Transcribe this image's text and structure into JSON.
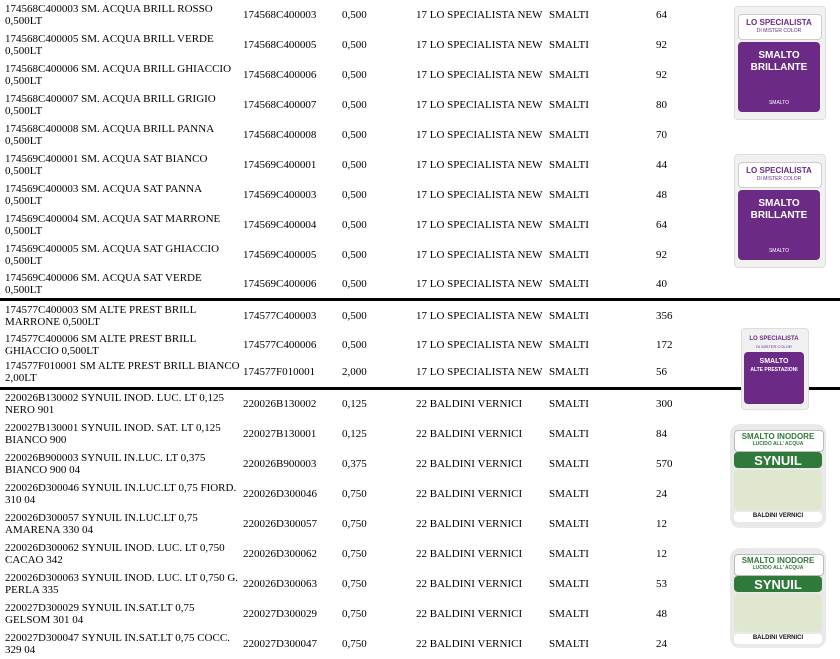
{
  "rows": [
    {
      "desc": "174568C400003 SM. ACQUA BRILL ROSSO\n0,500LT",
      "code": "174568C400003",
      "qty": "0,500",
      "supplier": "17 LO SPECIALISTA NEW",
      "category": "SMALTI",
      "value": "64"
    },
    {
      "desc": "174568C400005 SM. ACQUA BRILL VERDE\n0,500LT",
      "code": "174568C400005",
      "qty": "0,500",
      "supplier": "17 LO SPECIALISTA NEW",
      "category": "SMALTI",
      "value": "92"
    },
    {
      "desc": "174568C400006 SM. ACQUA BRILL GHIACCIO\n0,500LT",
      "code": "174568C400006",
      "qty": "0,500",
      "supplier": "17 LO SPECIALISTA NEW",
      "category": "SMALTI",
      "value": "92"
    },
    {
      "desc": "174568C400007 SM. ACQUA BRILL GRIGIO\n0,500LT",
      "code": "174568C400007",
      "qty": "0,500",
      "supplier": "17 LO SPECIALISTA NEW",
      "category": "SMALTI",
      "value": "80"
    },
    {
      "desc": "174568C400008 SM. ACQUA BRILL PANNA\n0,500LT",
      "code": "174568C400008",
      "qty": "0,500",
      "supplier": "17 LO SPECIALISTA NEW",
      "category": "SMALTI",
      "value": "70"
    },
    {
      "desc": "174569C400001 SM. ACQUA SAT BIANCO\n0,500LT",
      "code": "174569C400001",
      "qty": "0,500",
      "supplier": "17 LO SPECIALISTA NEW",
      "category": "SMALTI",
      "value": "44"
    },
    {
      "desc": "174569C400003 SM. ACQUA SAT PANNA\n0,500LT",
      "code": "174569C400003",
      "qty": "0,500",
      "supplier": "17 LO SPECIALISTA NEW",
      "category": "SMALTI",
      "value": "48"
    },
    {
      "desc": "174569C400004 SM. ACQUA SAT MARRONE\n0,500LT",
      "code": "174569C400004",
      "qty": "0,500",
      "supplier": "17 LO SPECIALISTA NEW",
      "category": "SMALTI",
      "value": "64"
    },
    {
      "desc": "174569C400005 SM. ACQUA SAT GHIACCIO\n0,500LT",
      "code": "174569C400005",
      "qty": "0,500",
      "supplier": "17 LO SPECIALISTA NEW",
      "category": "SMALTI",
      "value": "92"
    },
    {
      "desc": "174569C400006 SM. ACQUA SAT VERDE\n0,500LT",
      "code": "174569C400006",
      "qty": "0,500",
      "supplier": "17 LO SPECIALISTA NEW",
      "category": "SMALTI",
      "value": "40"
    },
    {
      "desc": "174577C400003 SM ALTE PREST BRILL\nMARRONE  0,500LT",
      "code": "174577C400003",
      "qty": "0,500",
      "supplier": "17 LO SPECIALISTA NEW",
      "category": "SMALTI",
      "value": "356"
    },
    {
      "desc": "174577C400006 SM ALTE PREST BRILL\nGHIACCIO 0,500LT",
      "code": "174577C400006",
      "qty": "0,500",
      "supplier": "17 LO SPECIALISTA NEW",
      "category": "SMALTI",
      "value": "172"
    },
    {
      "desc": "174577F010001 SM ALTE PREST BRILL BIANCO\n2,00LT",
      "code": "174577F010001",
      "qty": "2,000",
      "supplier": "17 LO SPECIALISTA NEW",
      "category": "SMALTI",
      "value": "56"
    },
    {
      "desc": "220026B130002 SYNUIL INOD. LUC. LT 0,125\nNERO 901",
      "code": "220026B130002",
      "qty": "0,125",
      "supplier": "22 BALDINI VERNICI",
      "category": "SMALTI",
      "value": "300"
    },
    {
      "desc": "220027B130001 SYNUIL INOD. SAT. LT 0,125\nBIANCO 900",
      "code": "220027B130001",
      "qty": "0,125",
      "supplier": "22 BALDINI VERNICI",
      "category": "SMALTI",
      "value": "84"
    },
    {
      "desc": "220026B900003 SYNUIL IN.LUC. LT 0,375\nBIANCO 900 04",
      "code": "220026B900003",
      "qty": "0,375",
      "supplier": "22 BALDINI VERNICI",
      "category": "SMALTI",
      "value": "570"
    },
    {
      "desc": "220026D300046 SYNUIL IN.LUC.LT 0,75 FIORD.\n310      04",
      "code": "220026D300046",
      "qty": "0,750",
      "supplier": "22 BALDINI VERNICI",
      "category": "SMALTI",
      "value": "24"
    },
    {
      "desc": "220026D300057 SYNUIL IN.LUC.LT 0,75\nAMARENA 330     04",
      "code": "220026D300057",
      "qty": "0,750",
      "supplier": "22 BALDINI VERNICI",
      "category": "SMALTI",
      "value": "12"
    },
    {
      "desc": "220026D300062 SYNUIL INOD. LUC. LT 0,750\nCACAO 342",
      "code": "220026D300062",
      "qty": "0,750",
      "supplier": "22 BALDINI VERNICI",
      "category": "SMALTI",
      "value": "12"
    },
    {
      "desc": "220026D300063 SYNUIL INOD. LUC. LT 0,750 G.\nPERLA 335",
      "code": "220026D300063",
      "qty": "0,750",
      "supplier": "22 BALDINI VERNICI",
      "category": "SMALTI",
      "value": "53"
    },
    {
      "desc": "220027D300029 SYNUIL IN.SAT.LT 0,75\nGELSOM 301      04",
      "code": "220027D300029",
      "qty": "0,750",
      "supplier": "22 BALDINI VERNICI",
      "category": "SMALTI",
      "value": "48"
    },
    {
      "desc": "220027D300047 SYNUIL IN.SAT.LT 0,75 COCC.\n329      04",
      "code": "220027D300047",
      "qty": "0,750",
      "supplier": "22 BALDINI VERNICI",
      "category": "SMALTI",
      "value": "24"
    }
  ],
  "products": {
    "smalto_brillante": {
      "brand": "LO SPECIALISTA",
      "sub": "DI MISTER COLOR",
      "line1": "SMALTO",
      "line2": "BRILLANTE",
      "foot": "SMALTO",
      "color": "#6a2a86"
    },
    "alte_prestazioni": {
      "brand": "LO SPECIALISTA",
      "sub": "DI MISTER COLOR",
      "line1": "SMALTO",
      "line2": "ALTE PRESTAZIONI",
      "color": "#6a2a86"
    },
    "synuil": {
      "head": "SMALTO INODORE",
      "subhead": "LUCIDO ALL' ACQUA",
      "name": "SYNUIL",
      "maker": "BALDINI VERNICI",
      "color": "#2f7a3a"
    }
  }
}
